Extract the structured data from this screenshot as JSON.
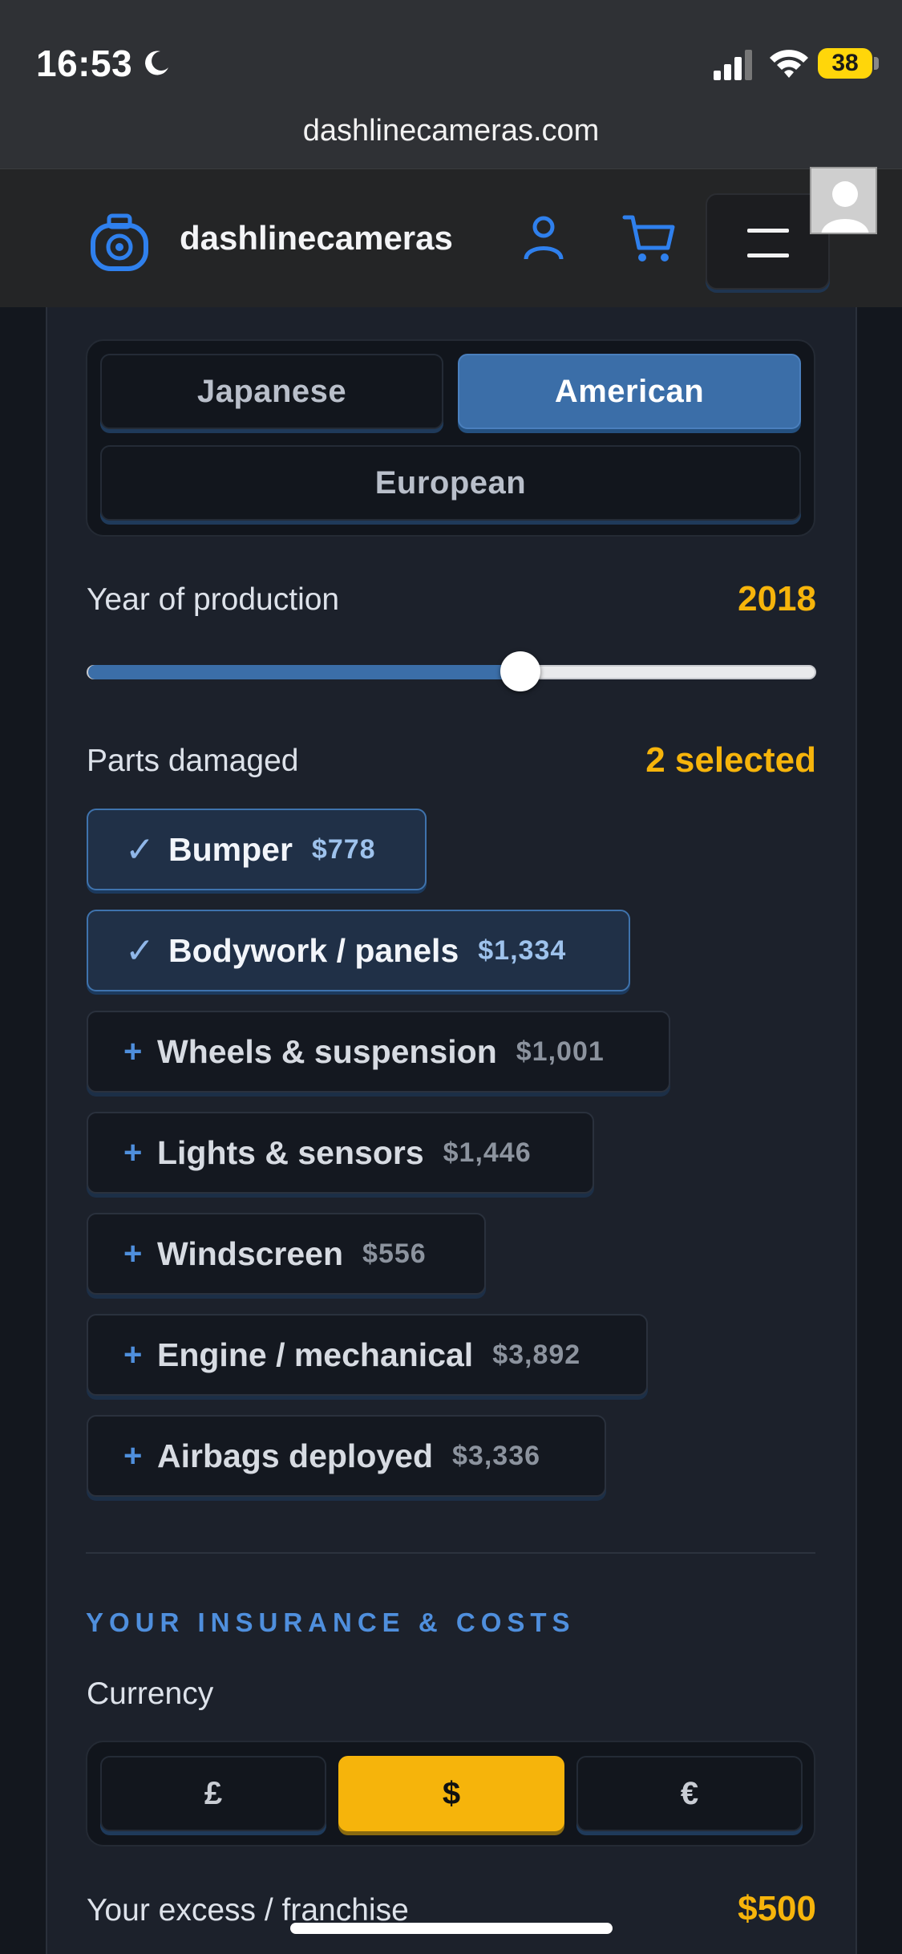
{
  "status": {
    "time": "16:53",
    "battery": "38",
    "url": "dashlinecameras.com"
  },
  "header": {
    "brand": "dashlinecameras"
  },
  "origin": {
    "options": [
      "Japanese",
      "American",
      "European"
    ],
    "selected": "American"
  },
  "year": {
    "label": "Year of production",
    "value": "2018",
    "fill_fraction": 0.595
  },
  "parts": {
    "label": "Parts damaged",
    "selected_text": "2 selected",
    "items": [
      {
        "name": "Bumper",
        "price": "$778",
        "selected": true
      },
      {
        "name": "Bodywork / panels",
        "price": "$1,334",
        "selected": true
      },
      {
        "name": "Wheels & suspension",
        "price": "$1,001",
        "selected": false
      },
      {
        "name": "Lights & sensors",
        "price": "$1,446",
        "selected": false
      },
      {
        "name": "Windscreen",
        "price": "$556",
        "selected": false
      },
      {
        "name": "Engine / mechanical",
        "price": "$3,892",
        "selected": false
      },
      {
        "name": "Airbags deployed",
        "price": "$3,336",
        "selected": false
      }
    ],
    "check_symbol": "✓",
    "plus_symbol": "+"
  },
  "insurance": {
    "section_title": "YOUR INSURANCE & COSTS",
    "currency_label": "Currency",
    "currencies": [
      "£",
      "$",
      "€"
    ],
    "selected_currency": "$",
    "excess_label": "Your excess / franchise",
    "excess_value": "$500"
  },
  "colors": {
    "accent_blue": "#3b6ea8",
    "accent_yellow": "#f6b40b",
    "panel_bg": "#1c212b"
  }
}
